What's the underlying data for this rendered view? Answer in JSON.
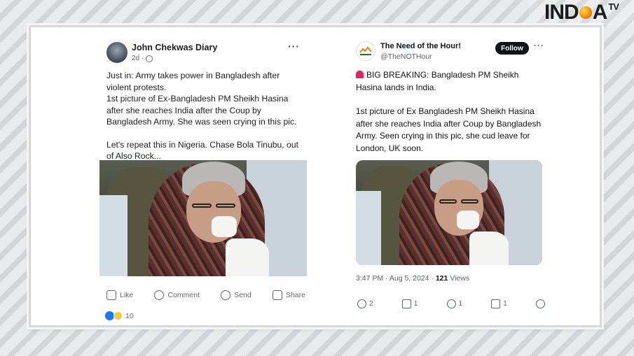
{
  "logo": {
    "left": "IND",
    "right": "A",
    "tv": "TV"
  },
  "facebook_post": {
    "author": "John Chekwas Diary",
    "time": "2d ·",
    "more": "···",
    "paragraphs": [
      "Just in: Army takes power in Bangladesh after violent protests.\n1st picture of Ex-Bangladesh PM Sheikh Hasina after she reaches India after the Coup by Bangladesh Army. She was seen crying in this pic.",
      "Let's repeat this in Nigeria. Chase Bola Tinubu, out of Also Rock..."
    ],
    "actions": {
      "like": "Like",
      "comment": "Comment",
      "send": "Send",
      "share": "Share"
    },
    "reaction_count": "10"
  },
  "twitter_post": {
    "name": "The Need of the Hour!",
    "handle": "@TheNOTHour",
    "follow_label": "Follow",
    "more": "···",
    "paragraphs": [
      "BIG BREAKING: Bangladesh PM Sheikh Hasina lands in India.",
      "1st picture of Ex Bangladesh PM Sheikh Hasina after she reaches India after Coup by Bangladesh Army. Seen crying in this pic, she cud leave for London, UK soon."
    ],
    "timestamp": "3:47 PM · Aug 5, 2024 · ",
    "views_count": "121",
    "views_label": " Views",
    "counts": {
      "reply": "2",
      "retweet": "1",
      "like": "1",
      "bookmark": "1"
    }
  },
  "colors": {
    "facebook_blue": "#1877f2",
    "follow_bg": "#0f1419",
    "siren": "#e0245e"
  }
}
